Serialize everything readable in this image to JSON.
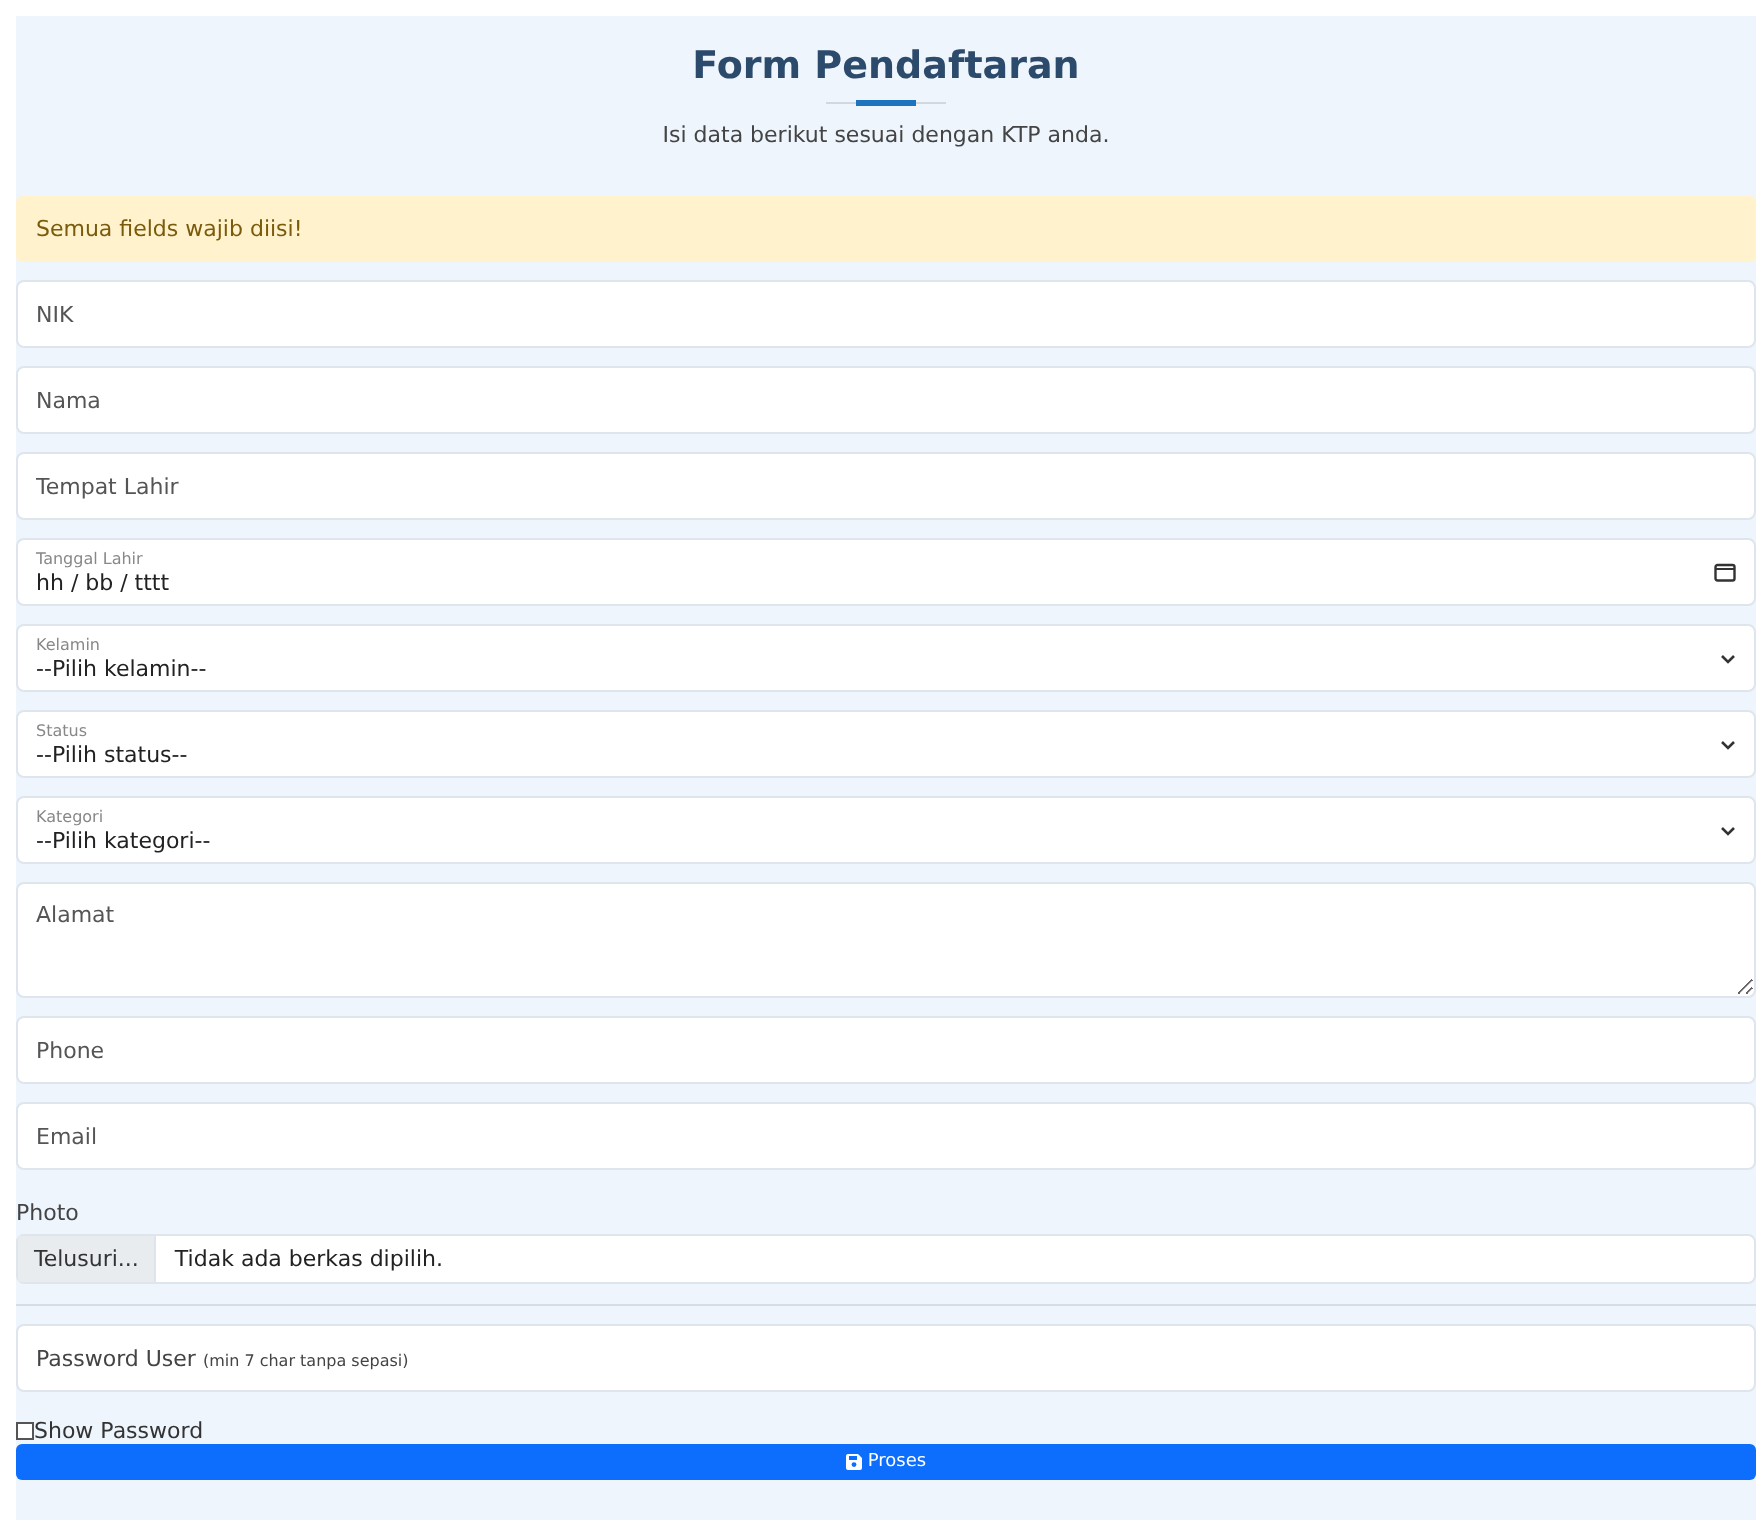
{
  "header": {
    "title": "Form Pendaftaran",
    "subtitle": "Isi data berikut sesuai dengan KTP anda."
  },
  "alert": "Semua fields wajib diisi!",
  "fields": [
    {
      "kind": "text",
      "placeholder": "NIK"
    },
    {
      "kind": "text",
      "placeholder": "Nama"
    },
    {
      "kind": "text",
      "placeholder": "Tempat Lahir"
    },
    {
      "kind": "date",
      "label": "Tanggal Lahir",
      "value": "hh / bb / tttt"
    },
    {
      "kind": "select",
      "label": "Kelamin",
      "value": "--Pilih kelamin--"
    },
    {
      "kind": "select",
      "label": "Status",
      "value": "--Pilih status--"
    },
    {
      "kind": "select",
      "label": "Kategori",
      "value": "--Pilih kategori--"
    },
    {
      "kind": "textarea",
      "placeholder": "Alamat"
    },
    {
      "kind": "text",
      "placeholder": "Phone"
    },
    {
      "kind": "text",
      "placeholder": "Email"
    },
    {
      "kind": "file",
      "label": "Photo",
      "button": "Telusuri...",
      "value": "Tidak ada berkas dipilih."
    },
    {
      "kind": "password",
      "placeholder": "Password User $_{(min 7 char tanpa sepasi)}$"
    }
  ],
  "show_password": {
    "label": "Show Password",
    "checked": false
  },
  "submit": "Proses"
}
